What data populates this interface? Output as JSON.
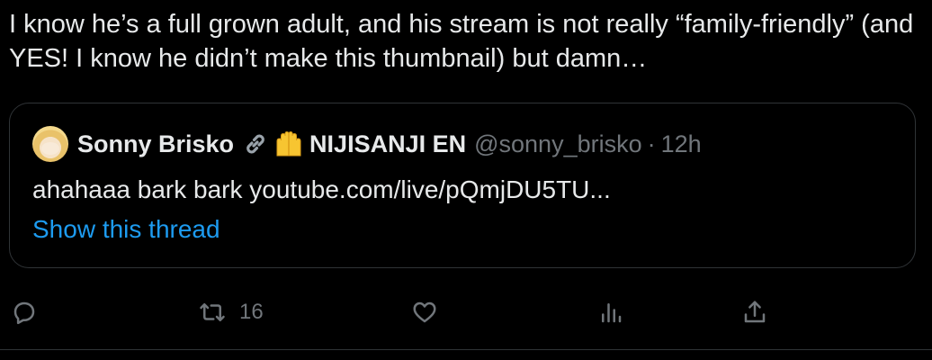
{
  "tweet": {
    "text": "I know he’s a full grown adult, and his stream is not really “family-friendly” (and YES! I know he didn’t make this thumbnail) but damn…"
  },
  "quote": {
    "display_name": "Sonny Brisko",
    "emoji_1": "link-emoji",
    "emoji_2": "raising-hands-emoji",
    "org_name": "NIJISANJI EN",
    "handle": "@sonny_brisko",
    "separator": "·",
    "time": "12h",
    "body": "ahahaaa bark bark youtube.com/live/pQmjDU5TU...",
    "show_thread": "Show this thread"
  },
  "actions": {
    "reply": {
      "icon": "reply-icon",
      "count": ""
    },
    "retweet": {
      "icon": "retweet-icon",
      "count": "16"
    },
    "like": {
      "icon": "heart-icon",
      "count": ""
    },
    "views": {
      "icon": "analytics-icon",
      "count": ""
    },
    "share": {
      "icon": "share-icon",
      "count": ""
    }
  },
  "colors": {
    "background": "#000000",
    "text": "#e7e9ea",
    "muted": "#71767b",
    "link": "#1d9bf0",
    "border": "#2f3336"
  }
}
